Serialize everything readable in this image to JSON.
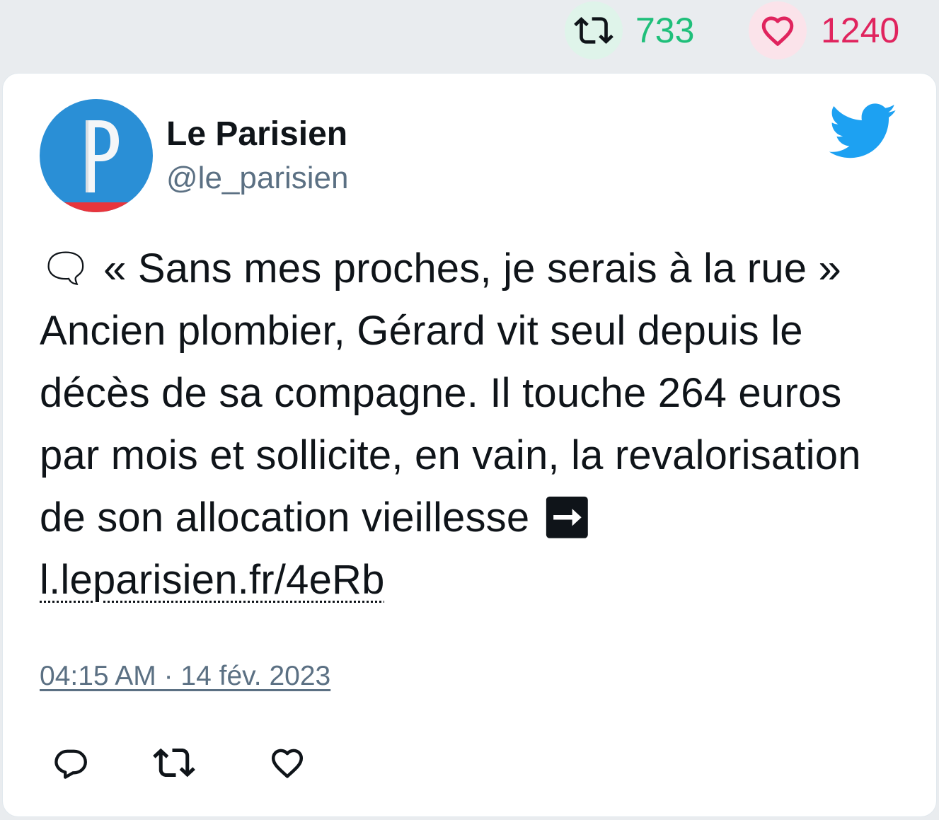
{
  "stats": {
    "retweets": "733",
    "likes": "1240"
  },
  "author": {
    "name": "Le Parisien",
    "handle": "@le_parisien",
    "avatar_letter": "P"
  },
  "tweet": {
    "text": "🗨 « Sans mes proches, je serais à la rue » Ancien plombier, Gérard vit seul depuis le décès de sa compagne. Il touche 264 euros par mois et sollicite, en vain, la revalorisation de son allocation vieillesse ➡ ",
    "link": "l.leparisien.fr/4eRb",
    "timestamp": "04:15 AM · 14 fév. 2023"
  },
  "colors": {
    "retweet_green": "#1fbf7a",
    "like_red": "#e0245e",
    "twitter_blue": "#1da1f2",
    "avatar_blue": "#2a8fd6",
    "avatar_red": "#e8353c",
    "handle_gray": "#5b7083"
  },
  "icons": {
    "stat_retweet": "retweet-icon",
    "stat_like": "heart-icon",
    "brand": "twitter-bird-icon",
    "reply": "reply-icon",
    "retweet": "retweet-icon",
    "like": "heart-icon"
  }
}
